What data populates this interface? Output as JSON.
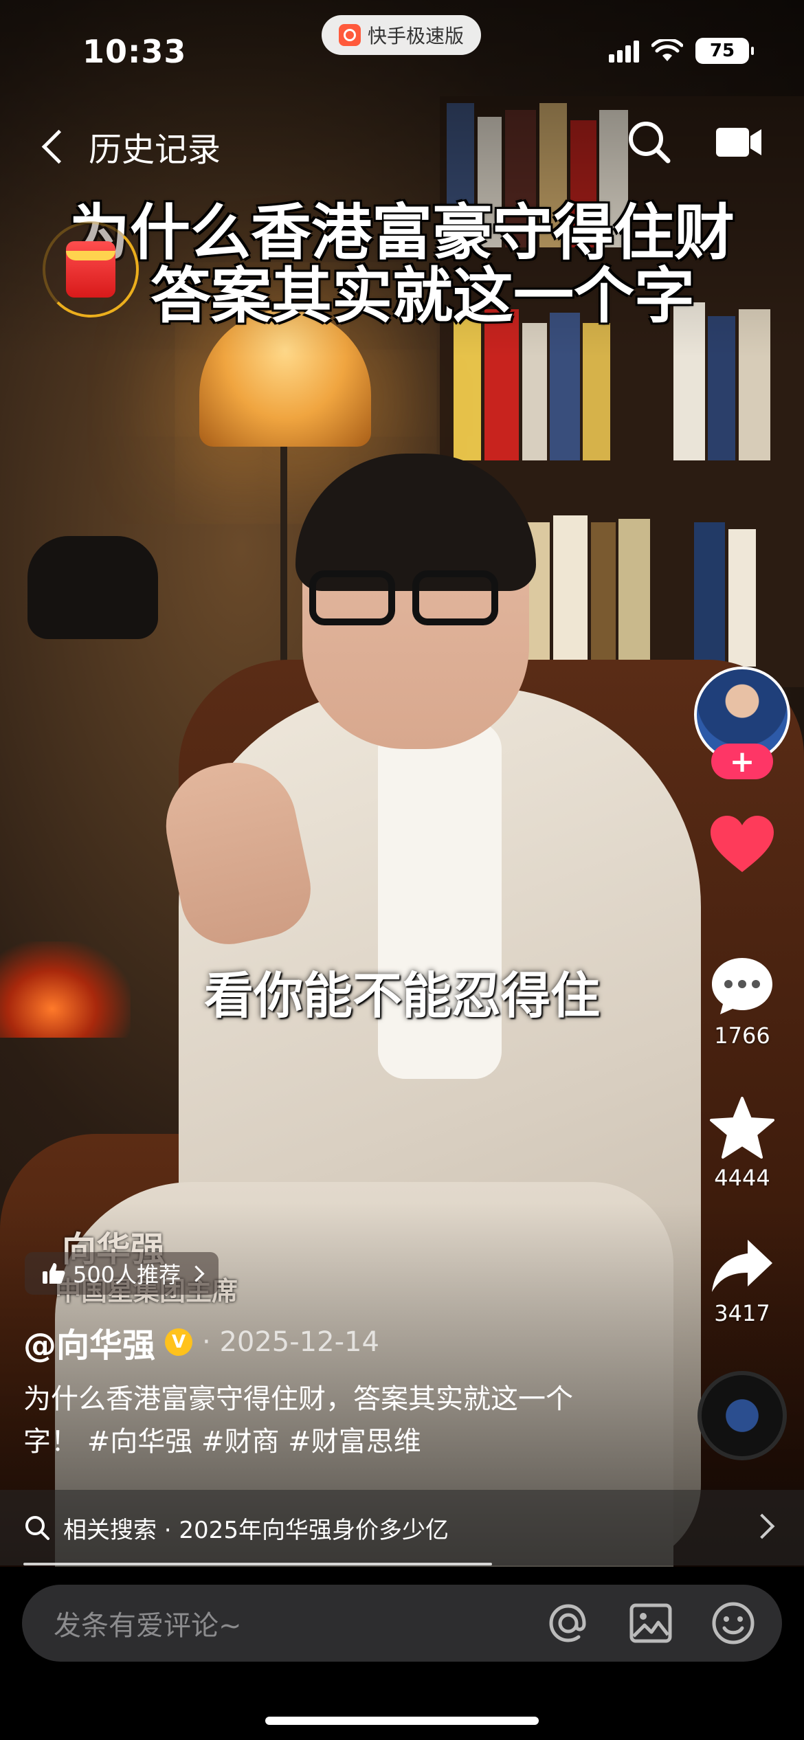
{
  "status_bar": {
    "time": "10:33",
    "app_badge": "快手极速版",
    "battery": "75"
  },
  "nav": {
    "back_title": "历史记录"
  },
  "video": {
    "headline_line1": "为什么香港富豪守得住财",
    "headline_line2": "答案其实就这一个字",
    "subtitle": "看你能不能忍得住",
    "watermark_name": "向华强",
    "watermark_title": "中国星集团主席"
  },
  "actions": {
    "follow_label": "+",
    "comments": "1766",
    "favorites": "4444",
    "shares": "3417"
  },
  "info": {
    "recommend": "500人推荐",
    "author": "@向华强",
    "date": "· 2025-12-14",
    "caption": "为什么香港富豪守得住财，答案其实就这一个字！ #向华强 #财商 #财富思维",
    "related_search": "相关搜索 · 2025年向华强身价多少亿",
    "progress": 0.62
  },
  "comment": {
    "placeholder": "发条有爱评论~"
  },
  "colors": {
    "like": "#fe3b5a",
    "follow": "#fe3666",
    "verified": "#ffc21c"
  }
}
